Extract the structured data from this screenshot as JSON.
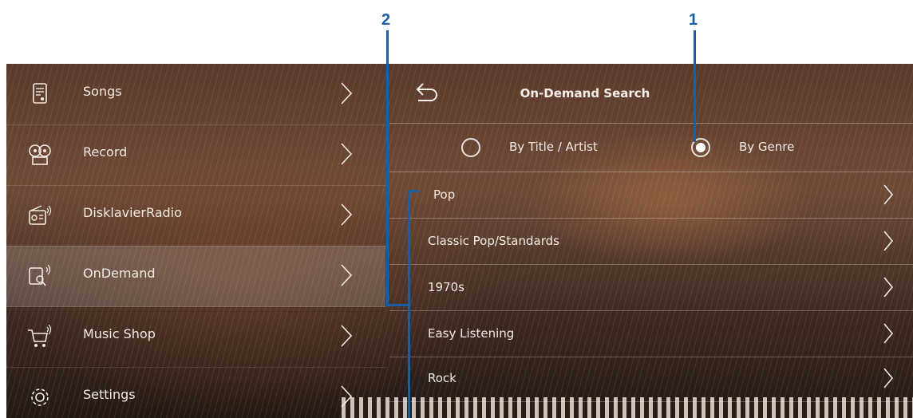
{
  "callouts": {
    "num1": "1",
    "num2": "2"
  },
  "sidebar": {
    "items": [
      {
        "label": "Songs",
        "icon": "songs-icon"
      },
      {
        "label": "Record",
        "icon": "record-icon"
      },
      {
        "label": "DisklavierRadio",
        "icon": "radio-icon"
      },
      {
        "label": "OnDemand",
        "icon": "ondemand-icon",
        "active": true
      },
      {
        "label": "Music Shop",
        "icon": "cart-icon"
      },
      {
        "label": "Settings",
        "icon": "gear-icon"
      }
    ]
  },
  "panel": {
    "title": "On-Demand Search",
    "search_modes": [
      {
        "label": "By Title / Artist",
        "selected": false
      },
      {
        "label": "By Genre",
        "selected": true
      }
    ],
    "genres": [
      "Pop",
      "Classic Pop/Standards",
      "1970s",
      "Easy Listening",
      "Rock"
    ]
  },
  "colors": {
    "callout": "#1a5fa3"
  }
}
